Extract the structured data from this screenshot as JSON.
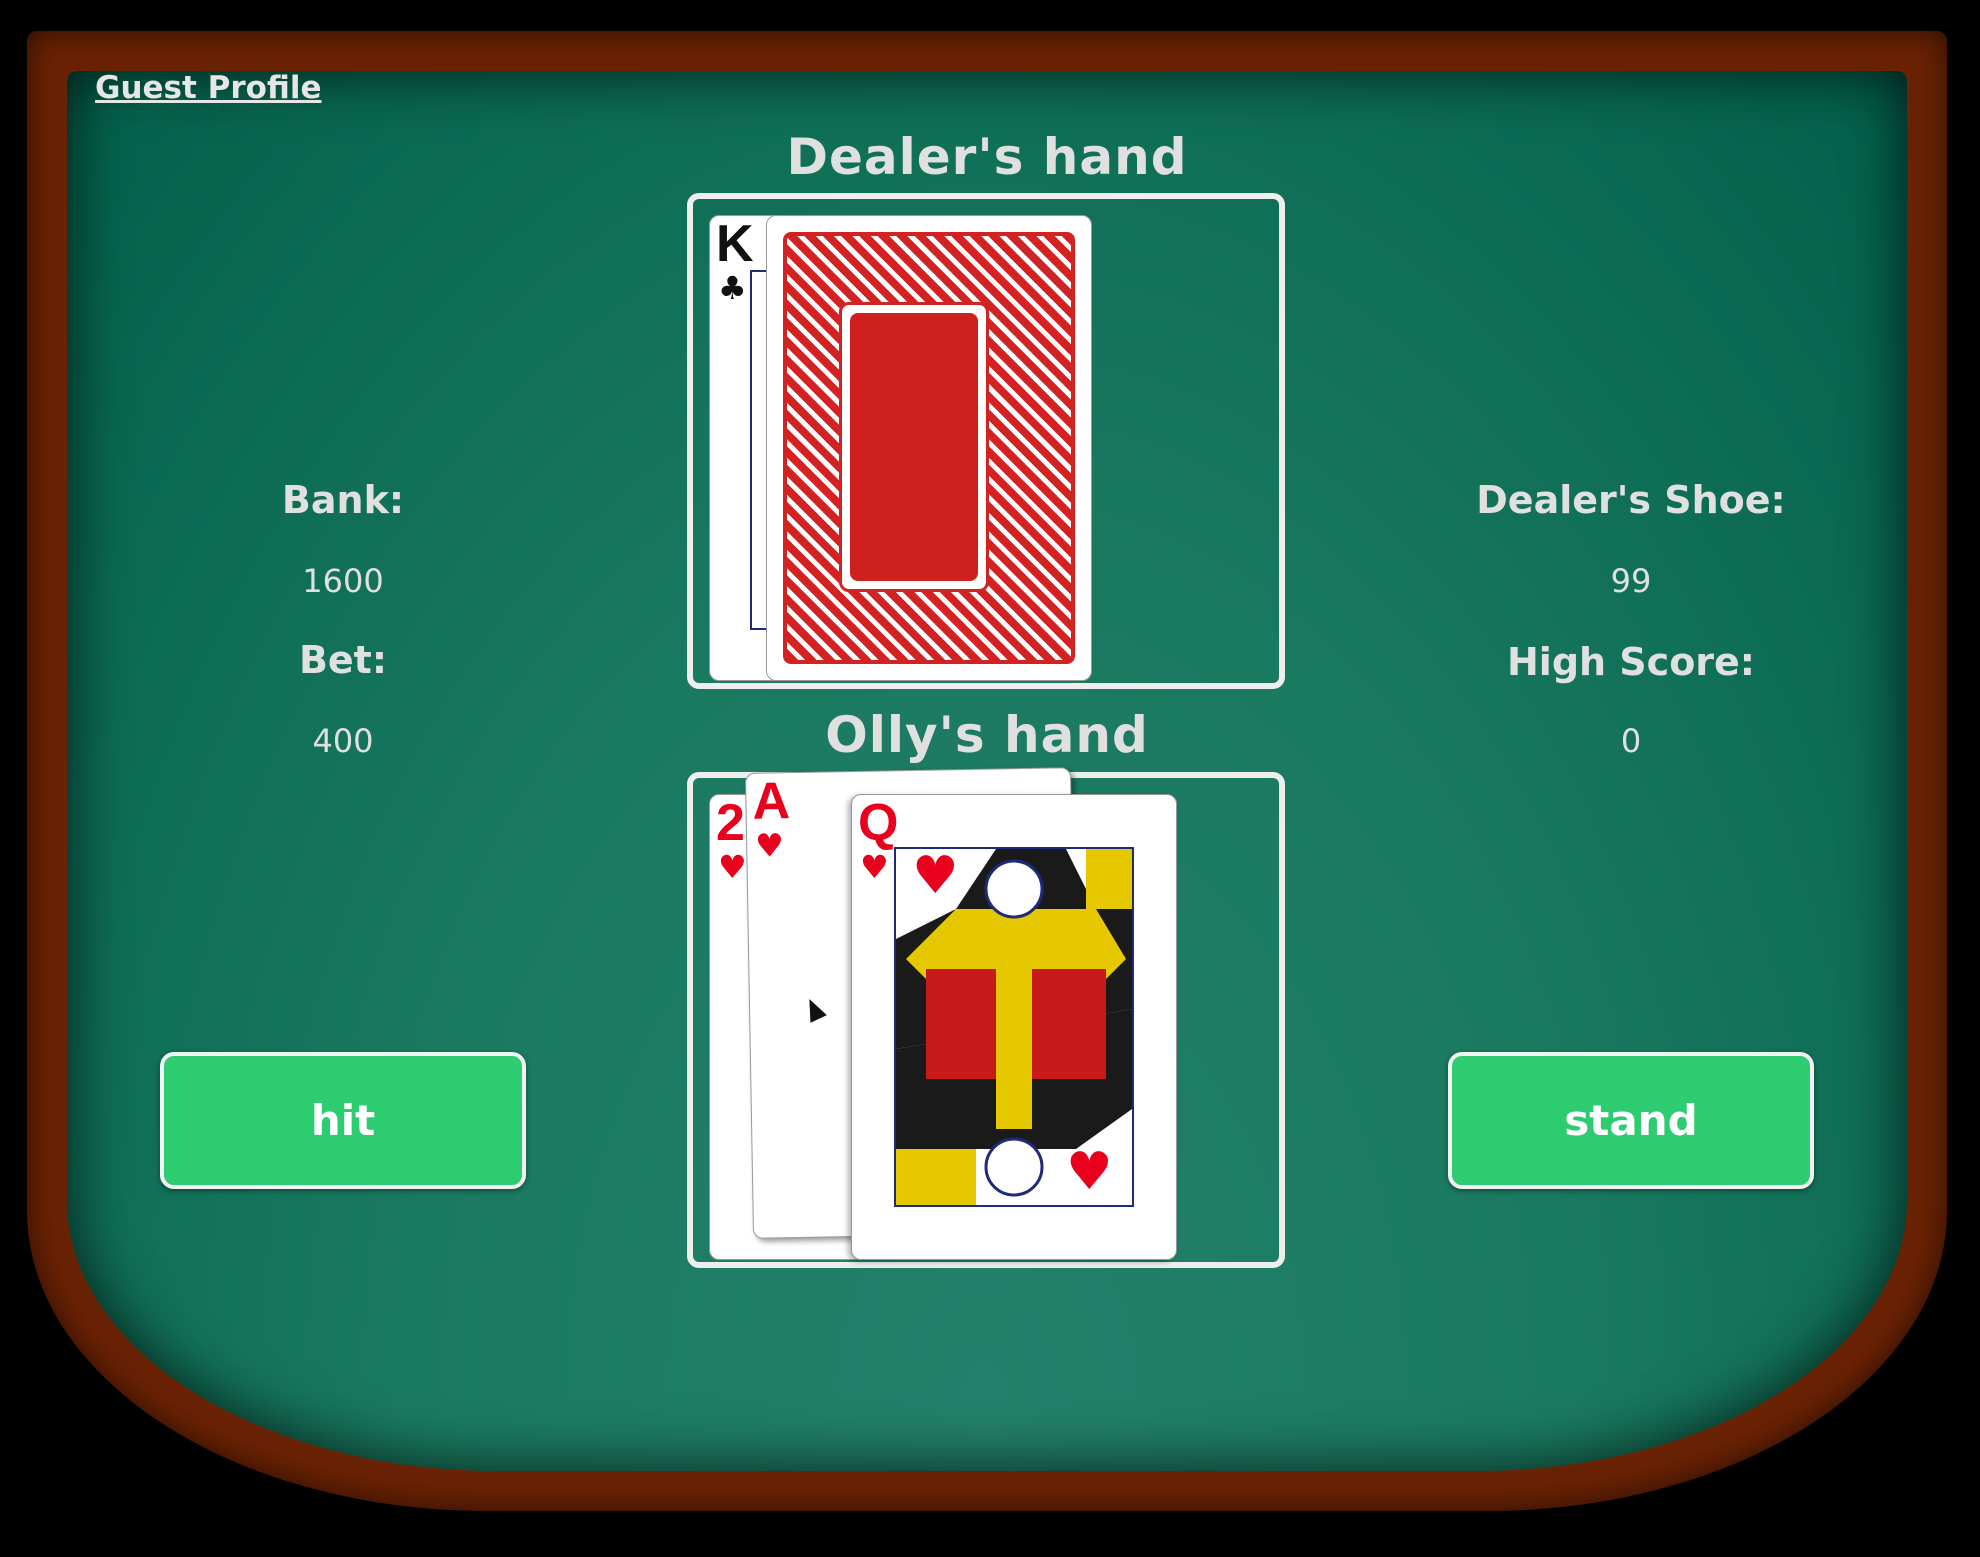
{
  "profile": {
    "label": "Guest Profile"
  },
  "dealer": {
    "title": "Dealer's hand",
    "cards": [
      {
        "rank": "K",
        "suit": "♣",
        "color": "black",
        "face_up": true
      },
      {
        "face_up": false,
        "back_color": "#d32222"
      }
    ]
  },
  "player": {
    "title": "Olly's hand",
    "cards": [
      {
        "rank": "2",
        "suit": "♥",
        "color": "red"
      },
      {
        "rank": "A",
        "suit": "♥",
        "color": "red"
      },
      {
        "rank": "Q",
        "suit": "♥",
        "color": "red"
      }
    ]
  },
  "stats": {
    "bank_label": "Bank:",
    "bank_value": "1600",
    "bet_label": "Bet:",
    "bet_value": "400",
    "shoe_label": "Dealer's Shoe:",
    "shoe_value": "99",
    "high_score_label": "High Score:",
    "high_score_value": "0"
  },
  "buttons": {
    "hit": "hit",
    "stand": "stand"
  },
  "colors": {
    "felt": "#1a7a60",
    "rim": "#6a2204",
    "button": "#2ecc71",
    "text": "#e0e0e0"
  }
}
